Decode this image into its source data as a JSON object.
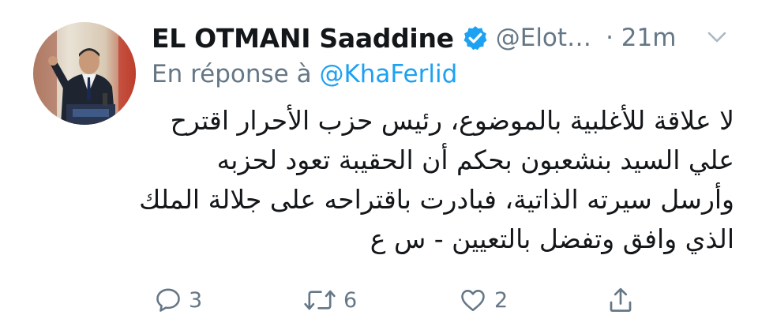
{
  "tweet": {
    "author_name": "EL OTMANI Saaddine",
    "handle": "@Elot…",
    "time": "· 21m",
    "reply_prefix": "En réponse à",
    "reply_mention": "@KhaFerlid",
    "body_lines": [
      "لا علاقة للأغلبية بالموضوع، رئيس حزب الأحرار اقترح",
      "علي السيد بنشعبون بحكم أن الحقيبة تعود لحزبه",
      "وأرسل سيرته الذاتية، فبادرت باقتراحه على جلالة الملك",
      "الذي وافق وتفضل بالتعيين - س ع"
    ]
  },
  "actions": {
    "reply_count": "3",
    "retweet_count": "6",
    "like_count": "2"
  },
  "icons": {
    "verified": "verified-badge-icon",
    "caret": "chevron-down-icon",
    "reply": "reply-bubble-icon",
    "retweet": "retweet-icon",
    "like": "heart-icon",
    "share": "share-icon"
  },
  "colors": {
    "text": "#14171a",
    "secondary": "#657786",
    "accent": "#1da1f2"
  }
}
